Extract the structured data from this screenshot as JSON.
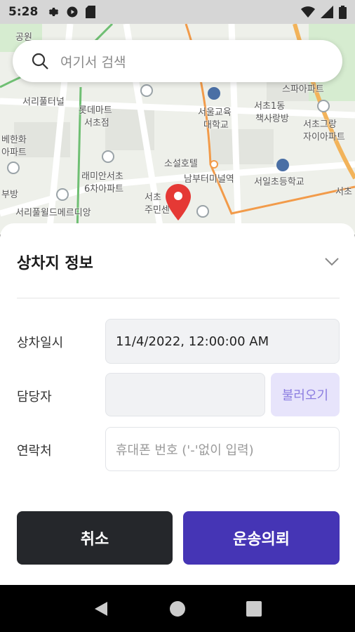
{
  "status_bar": {
    "time": "5:28",
    "left_icons": [
      "gear-icon",
      "play-icon",
      "sd-card-icon"
    ],
    "right_icons": [
      "wifi-icon",
      "signal-icon",
      "battery-icon"
    ]
  },
  "map": {
    "labels": [
      "공원",
      "서리풀터널",
      "롯데마트",
      "서초점",
      "서울교육",
      "대학교",
      "서초1동",
      "책사랑방",
      "스파아파트",
      "서초그랑",
      "자이아파트",
      "베한화",
      "아파트",
      "소설호텔",
      "남부터미널역",
      "서일초등학교",
      "래미안서초",
      "6차아파트",
      "서초",
      "주민센",
      "부방",
      "서리풀윌드메르디앙",
      "서초"
    ],
    "accent_road_color": "#f29b4a",
    "green_road_color": "#6fbf73"
  },
  "search": {
    "placeholder": "여기서 검색"
  },
  "sheet": {
    "title": "상차지 정보",
    "fields": {
      "datetime_label": "상차일시",
      "datetime_value": "11/4/2022, 12:00:00 AM",
      "manager_label": "담당자",
      "manager_value": "",
      "load_button": "불러오기",
      "contact_label": "연락처",
      "contact_placeholder": "휴대폰 번호 ('-'없이 입력)"
    },
    "buttons": {
      "cancel": "취소",
      "request": "운송의뢰"
    }
  },
  "colors": {
    "primary": "#4535b5",
    "dark": "#25272b",
    "load_btn_bg": "#e7e4fb",
    "load_btn_text": "#8b7de0",
    "pin": "#e53935"
  },
  "nav_bar": {
    "icons": [
      "back-icon",
      "home-icon",
      "recents-icon"
    ]
  }
}
